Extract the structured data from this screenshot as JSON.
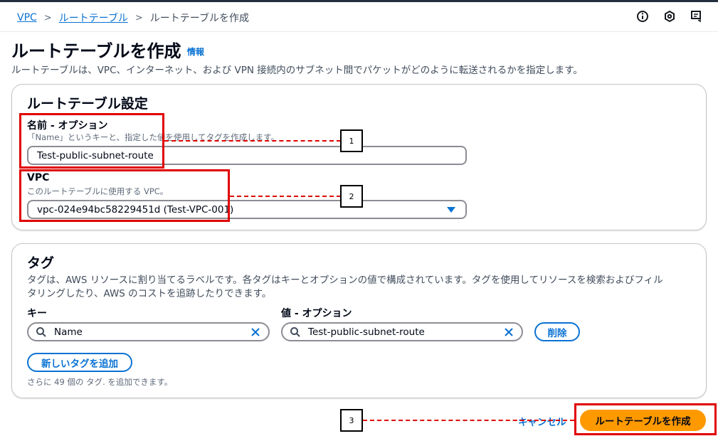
{
  "breadcrumb": {
    "items": [
      "VPC",
      "ルートテーブル"
    ],
    "current": "ルートテーブルを作成"
  },
  "top_icons": [
    "info-circle-icon",
    "hexagon-settings-icon",
    "feedback-icon"
  ],
  "page": {
    "title": "ルートテーブルを作成",
    "info_link": "情報",
    "description": "ルートテーブルは、VPC、インターネット、および VPN 接続内のサブネット間でパケットがどのように転送されるかを指定します。"
  },
  "settings_panel": {
    "title": "ルートテーブル設定",
    "name_label": "名前 - オプション",
    "name_desc": "「Name」というキーと、指定した値を使用してタグを作成します。",
    "name_value": "Test-public-subnet-route",
    "vpc_label": "VPC",
    "vpc_desc": "このルートテーブルに使用する VPC。",
    "vpc_value": "vpc-024e94bc58229451d (Test-VPC-001)"
  },
  "tags_panel": {
    "title": "タグ",
    "desc_line1": "タグは、AWS リソースに割り当てるラベルです。各タグはキーとオプションの値で構成されています。タグを使用してリソースを検索およびフィル",
    "desc_line2": "タリングしたり、AWS のコストを追跡したりできます。",
    "key_label": "キー",
    "value_label": "値 - オプション",
    "key_value": "Name",
    "value_value": "Test-public-subnet-route",
    "remove_button": "削除",
    "add_tag_button": "新しいタグを追加",
    "remaining_note": "さらに 49 個の タグ. を追加できます。"
  },
  "footer": {
    "cancel": "キャンセル",
    "create": "ルートテーブルを作成"
  },
  "annotations": {
    "callout_1": "1",
    "callout_2": "2",
    "callout_3": "3",
    "color": "#e00000"
  },
  "colors": {
    "link": "#0972d3",
    "primary_button": "#ff9900",
    "annotation": "#e00000"
  }
}
